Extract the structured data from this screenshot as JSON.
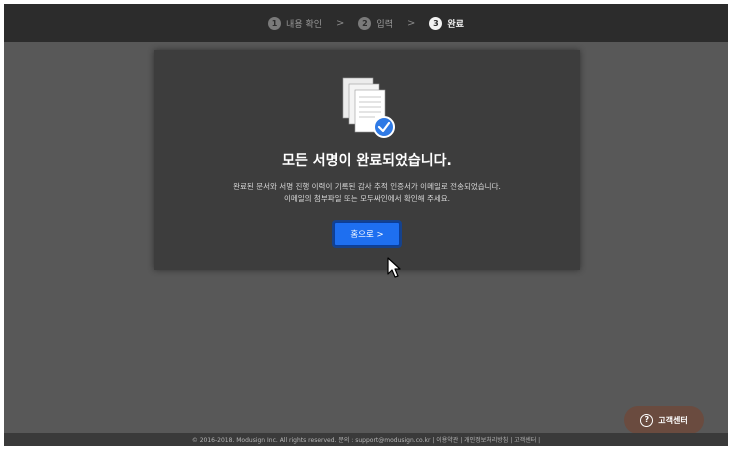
{
  "steps": [
    {
      "num": "1",
      "label": "내용 확인"
    },
    {
      "num": "2",
      "label": "입력"
    },
    {
      "num": "3",
      "label": "완료"
    }
  ],
  "step_separator": ">",
  "dialog": {
    "title": "모든 서명이 완료되었습니다.",
    "description_line1": "완료된 문서와 서명 진행 이력이 기록된 감사 추적 인증서가 이메일로 전송되었습니다.",
    "description_line2": "이메일의 첨부파일 또는 모두싸인에서 확인해 주세요.",
    "home_button_label": "홈으로 >"
  },
  "help_button": {
    "icon": "?",
    "label": "고객센터"
  },
  "footer": {
    "text": "© 2016-2018. Modusign Inc. All rights reserved.  문의 : support@modusign.co.kr  |  이용약관  |  개인정보처리방침  |  고객센터  |"
  },
  "colors": {
    "background": "#585858",
    "topbar": "#2c2c2c",
    "card": "#3d3d3d",
    "primary_button": "#1e6ff0",
    "check_badge": "#2f7ae5",
    "help_button": "#6a4b3f"
  }
}
